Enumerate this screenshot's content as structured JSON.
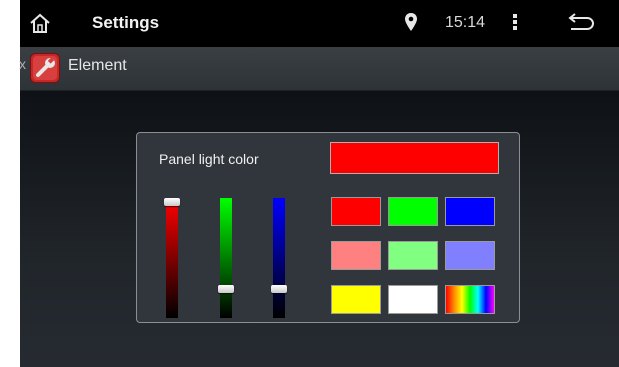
{
  "status_bar": {
    "title": "Settings",
    "time": "15:14",
    "icons": [
      "home-icon",
      "location-pin-icon",
      "more-vert-icon",
      "back-icon"
    ]
  },
  "app_bar": {
    "nav_char": "x",
    "title": "Element",
    "icon": "wrench-settings-icon"
  },
  "panel": {
    "label": "Panel light color",
    "selected_color": "#ff0000",
    "sliders": [
      {
        "channel": "red",
        "value": 1.0,
        "color": "#ff0000"
      },
      {
        "channel": "green",
        "value": 0.22,
        "color": "#00ff00"
      },
      {
        "channel": "blue",
        "value": 0.22,
        "color": "#0000ff"
      }
    ],
    "swatches": [
      {
        "name": "red",
        "color": "#ff0000"
      },
      {
        "name": "green",
        "color": "#00ff00"
      },
      {
        "name": "blue",
        "color": "#0000ff"
      },
      {
        "name": "light-red",
        "color": "#ff8080"
      },
      {
        "name": "light-green",
        "color": "#80ff80"
      },
      {
        "name": "light-blue",
        "color": "#8080ff"
      },
      {
        "name": "yellow",
        "color": "#ffff00"
      },
      {
        "name": "white",
        "color": "#ffffff"
      },
      {
        "name": "rainbow",
        "color": "rainbow"
      }
    ]
  }
}
